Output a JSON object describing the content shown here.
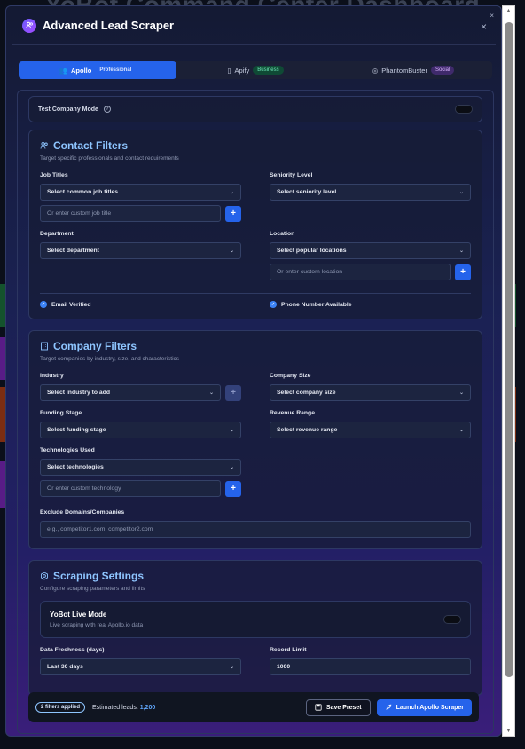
{
  "background": {
    "title": "YoBot Command Center Dashboard"
  },
  "modal": {
    "title": "Advanced Lead Scraper",
    "close": "×",
    "corner_close": "×"
  },
  "tabs": [
    {
      "label": "Apollo",
      "badge": "Professional"
    },
    {
      "label": "Apify",
      "badge": "Business"
    },
    {
      "label": "PhantomBuster",
      "badge": "Social"
    }
  ],
  "test_mode": {
    "label": "Test Company Mode",
    "help": "?"
  },
  "contact": {
    "title": "Contact Filters",
    "subtitle": "Target specific professionals and contact requirements",
    "job_titles": {
      "label": "Job Titles",
      "select": "Select common job titles",
      "placeholder": "Or enter custom job title"
    },
    "seniority": {
      "label": "Seniority Level",
      "select": "Select seniority level"
    },
    "department": {
      "label": "Department",
      "select": "Select department"
    },
    "location": {
      "label": "Location",
      "select": "Select popular locations",
      "placeholder": "Or enter custom location"
    },
    "email_verified": "Email Verified",
    "phone_available": "Phone Number Available"
  },
  "company": {
    "title": "Company Filters",
    "subtitle": "Target companies by industry, size, and characteristics",
    "industry": {
      "label": "Industry",
      "select": "Select industry to add"
    },
    "size": {
      "label": "Company Size",
      "select": "Select company size"
    },
    "funding": {
      "label": "Funding Stage",
      "select": "Select funding stage"
    },
    "revenue": {
      "label": "Revenue Range",
      "select": "Select revenue range"
    },
    "tech": {
      "label": "Technologies Used",
      "select": "Select technologies",
      "placeholder": "Or enter custom technology"
    },
    "exclude": {
      "label": "Exclude Domains/Companies",
      "placeholder": "e.g., competitor1.com, competitor2.com"
    }
  },
  "scraping": {
    "title": "Scraping Settings",
    "subtitle": "Configure scraping parameters and limits",
    "live_title": "YoBot Live Mode",
    "live_sub": "Live scraping with real Apollo.io data",
    "freshness_label": "Data Freshness (days)",
    "freshness_value": "Last 30 days",
    "record_label": "Record Limit",
    "record_value": "1000"
  },
  "footer": {
    "badge": "2 filters applied",
    "estimate_label": "Estimated leads:",
    "estimate_value": "1,200",
    "save": "Save Preset",
    "launch": "Launch Apollo Scraper"
  },
  "scrollbar": {
    "up": "▲",
    "down": "▼"
  }
}
